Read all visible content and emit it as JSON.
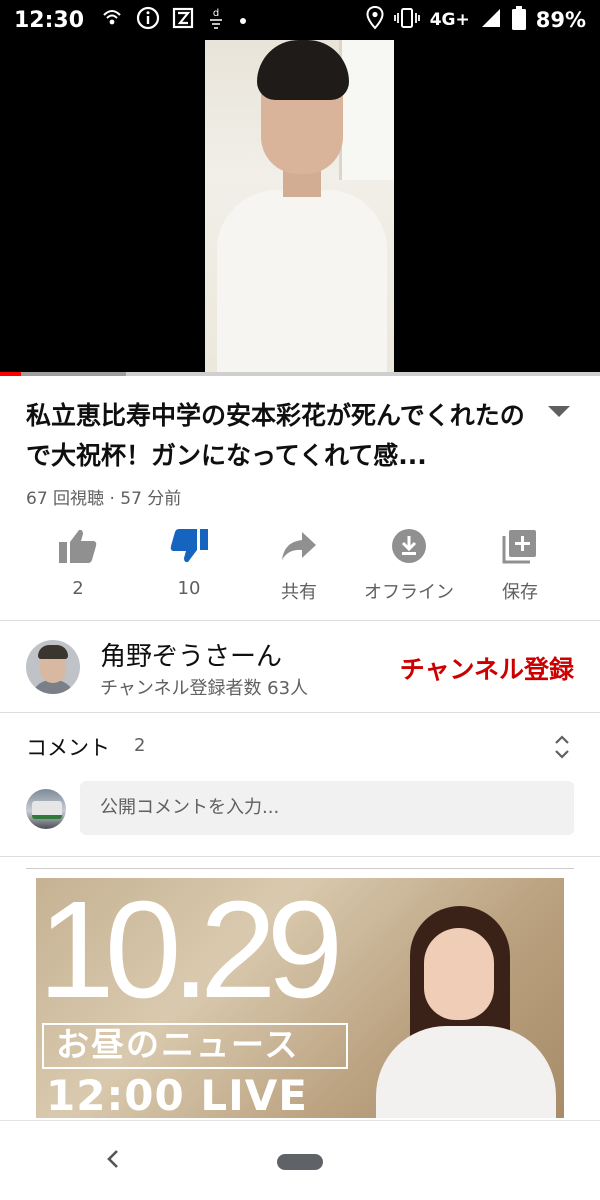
{
  "status_bar": {
    "time": "12:30",
    "left_icons": [
      "hotspot-icon",
      "info-icon",
      "app-icon",
      "dmenu-icon",
      "dot-icon"
    ],
    "network": "4G+",
    "battery": "89%"
  },
  "video": {
    "played_fraction": 0.035,
    "buffered_fraction": 0.21
  },
  "video_info": {
    "title": "私立恵比寿中学の安本彩花が死んでくれたので大祝杯！ガンになってくれて感...",
    "meta": "67 回視聴 · 57 分前"
  },
  "actions": {
    "like": "2",
    "dislike": "10",
    "share": "共有",
    "offline": "オフライン",
    "save": "保存",
    "accent": "#1565c0"
  },
  "channel": {
    "name": "角野ぞうさーん",
    "subscribers": "チャンネル登録者数 63人",
    "subscribe_label": "チャンネル登録",
    "subscribe_color": "#cc0000"
  },
  "comments": {
    "label": "コメント",
    "count": "2",
    "placeholder": "公開コメントを入力..."
  },
  "next_video": {
    "date": "10.29",
    "subtitle": "お昼のニュース",
    "live": "12:00 LIVE"
  }
}
